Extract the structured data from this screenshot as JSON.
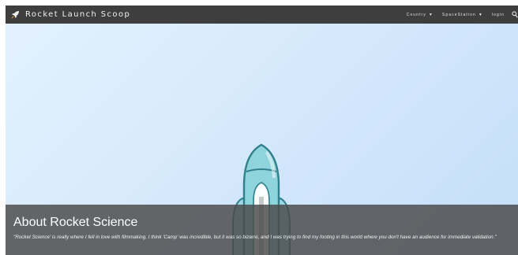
{
  "app": {
    "title": "Rocket Launch Scoop",
    "logo_icon": "rocket-icon"
  },
  "nav": {
    "items": [
      {
        "label": "Country",
        "has_dropdown": true
      },
      {
        "label": "SpaceStation",
        "has_dropdown": true
      },
      {
        "label": "login",
        "has_dropdown": false
      }
    ],
    "search_icon": "search-icon"
  },
  "hero": {
    "illustration": "rocket-illustration"
  },
  "about": {
    "title": "About Rocket Science",
    "quote": "\"Rocket Science' is really where I fell in love with filmmaking. I think 'Camp' was incredible, but it was so bizarre, and I was trying to find my footing in this world where you don't have an audience for immediate validation.\""
  },
  "colors": {
    "navbar": "#3e3e3e",
    "hero_light": "#e3f1fe",
    "hero_dark": "#c4def8",
    "overlay": "#4b4b4b",
    "rocket_body": "#8fd3dc",
    "rocket_outline": "#2f7f8c"
  }
}
